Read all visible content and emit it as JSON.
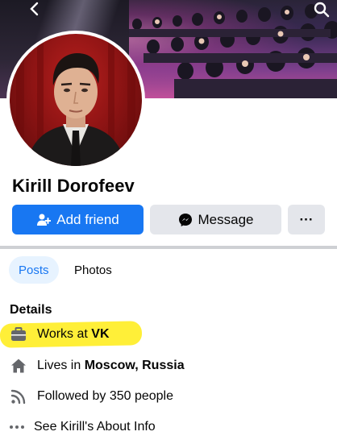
{
  "profile": {
    "name": "Kirill Dorofeev"
  },
  "actions": {
    "add_friend": "Add friend",
    "message": "Message",
    "more": "···"
  },
  "tabs": {
    "posts": "Posts",
    "photos": "Photos"
  },
  "details": {
    "title": "Details",
    "work_prefix": "Works at",
    "work_place": "VK",
    "lives_prefix": "Lives in",
    "lives_place": "Moscow, Russia",
    "followed": "Followed by 350 people",
    "about": "See Kirill's About Info"
  },
  "colors": {
    "accent": "#1877f2",
    "button_gray": "#e4e6eb",
    "highlight": "#ffea00"
  },
  "icons": [
    "back-icon",
    "search-icon",
    "add-friend-icon",
    "messenger-icon",
    "more-icon",
    "briefcase-icon",
    "home-icon",
    "rss-icon",
    "ellipsis-icon"
  ]
}
